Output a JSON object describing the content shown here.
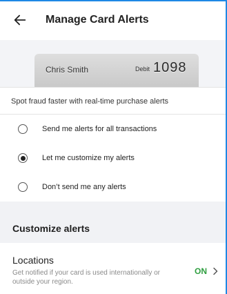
{
  "header": {
    "title": "Manage Card Alerts",
    "back_icon": "arrow-left-icon"
  },
  "card": {
    "name": "Chris Smith",
    "type": "Debit",
    "last4": "1098"
  },
  "intro": "Spot fraud faster with real-time purchase alerts",
  "options": [
    {
      "label": "Send me alerts for all transactions",
      "selected": false
    },
    {
      "label": "Let me customize my alerts",
      "selected": true
    },
    {
      "label": "Don’t send me any alerts",
      "selected": false
    }
  ],
  "section_title": "Customize alerts",
  "locations": {
    "title": "Locations",
    "subtitle": "Get notified if your card is used internationally or outside your region.",
    "status": "ON",
    "chevron_icon": "chevron-right-icon"
  },
  "colors": {
    "accent": "#1e88e5",
    "status_on": "#2e9e3f"
  }
}
